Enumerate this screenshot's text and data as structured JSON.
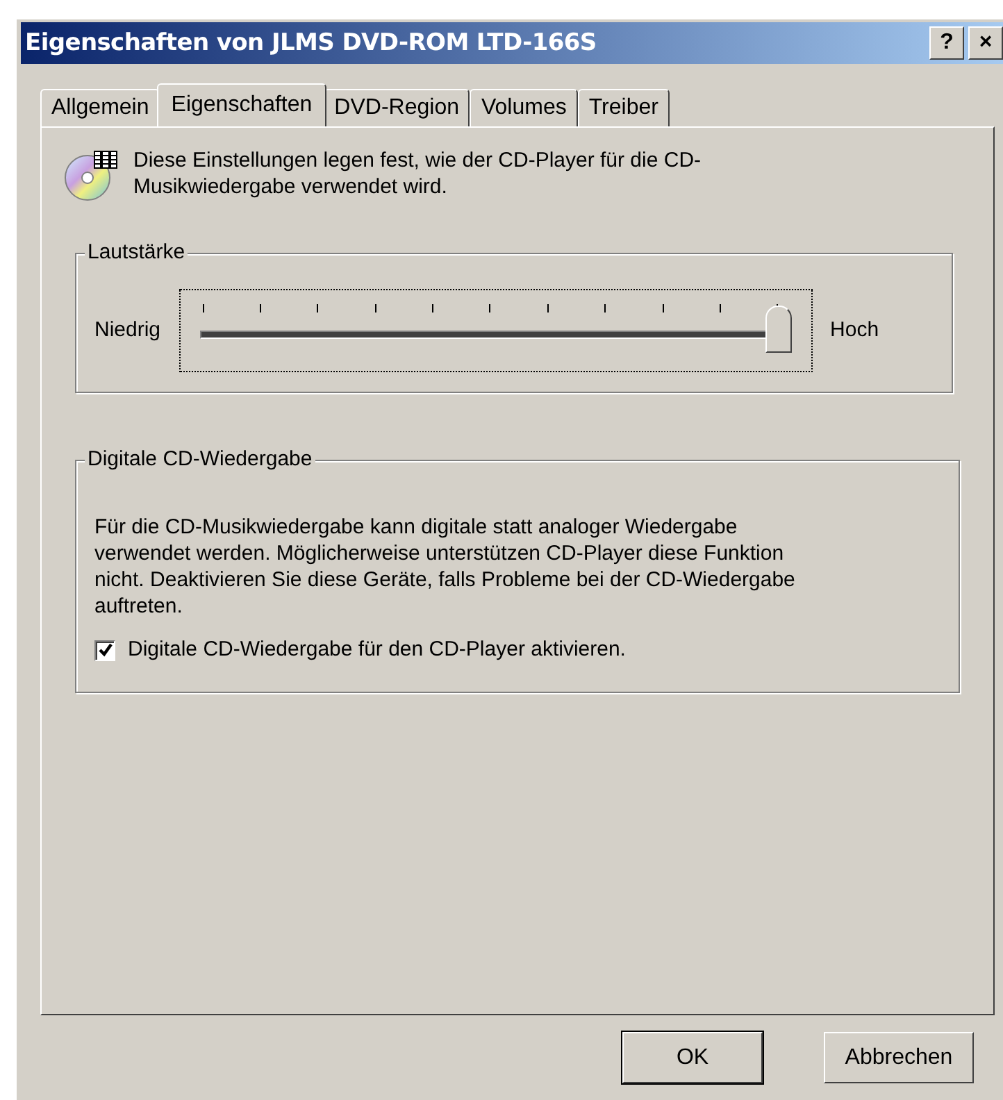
{
  "window": {
    "title": "Eigenschaften von JLMS DVD-ROM LTD-166S",
    "title_buttons": [
      "?",
      "×"
    ]
  },
  "tabs": [
    {
      "label": "Allgemein",
      "selected": false
    },
    {
      "label": "Eigenschaften",
      "selected": true
    },
    {
      "label": "DVD-Region",
      "selected": false
    },
    {
      "label": "Volumes",
      "selected": false
    },
    {
      "label": "Treiber",
      "selected": false
    }
  ],
  "intro": "Diese Einstellungen legen fest, wie der CD-Player für die CD-Musikwiedergabe verwendet wird.",
  "volume": {
    "title": "Lautstärke",
    "low_label": "Niedrig",
    "high_label": "Hoch",
    "level": 1.0
  },
  "digital": {
    "title": "Digitale CD-Wiedergabe",
    "description": "Für die CD-Musikwiedergabe kann digitale statt analoger Wiedergabe verwendet werden. Möglicherweise unterstützen CD-Player diese Funktion nicht. Deaktivieren Sie diese Geräte, falls Probleme bei der CD-Wiedergabe auftreten.",
    "checkbox": {
      "label": "Digitale CD-Wiedergabe für den CD-Player aktivieren.",
      "checked": true
    }
  },
  "buttons": [
    {
      "label": "OK",
      "default": true
    },
    {
      "label": "Abbrechen",
      "default": false
    }
  ]
}
